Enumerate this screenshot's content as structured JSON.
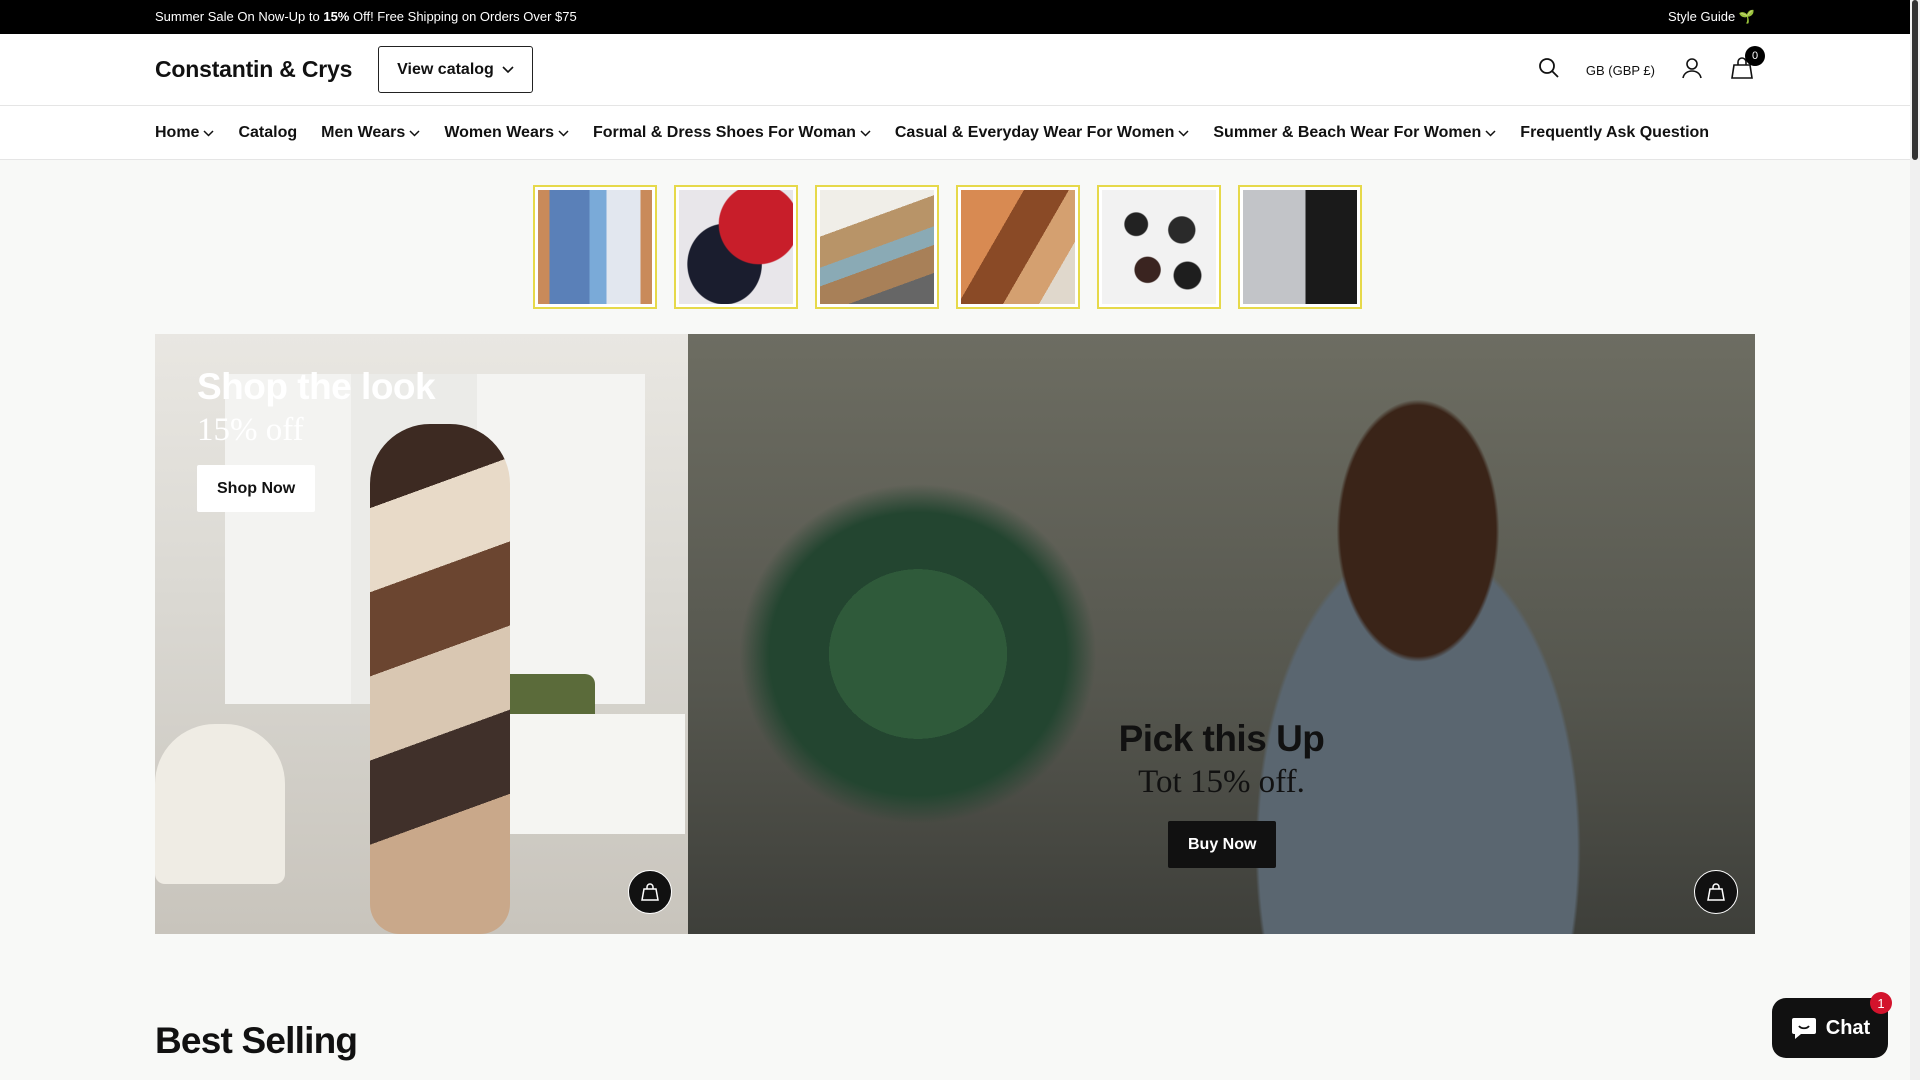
{
  "announcement": {
    "text_before": "Summer Sale On Now-Up to ",
    "text_bold": "15%",
    "text_after": " Off! Free Shipping on Orders Over $75",
    "style_guide": "Style Guide 🌱"
  },
  "header": {
    "logo": "Constantin & Crys",
    "catalog_button": "View catalog",
    "currency": "GB (GBP £)",
    "cart_count": "0"
  },
  "nav": {
    "items": [
      {
        "label": "Home",
        "dropdown": true
      },
      {
        "label": "Catalog",
        "dropdown": false
      },
      {
        "label": "Men Wears",
        "dropdown": true
      },
      {
        "label": "Women Wears",
        "dropdown": true
      },
      {
        "label": "Formal & Dress Shoes For Woman",
        "dropdown": true
      },
      {
        "label": "Casual & Everyday Wear For Women",
        "dropdown": true
      },
      {
        "label": "Summer & Beach Wear For Women",
        "dropdown": true
      },
      {
        "label": "Frequently Ask Question",
        "dropdown": false
      }
    ]
  },
  "thumbnails": [
    {
      "name": "shirts-and-jeans"
    },
    {
      "name": "caps"
    },
    {
      "name": "sneakers"
    },
    {
      "name": "accessories"
    },
    {
      "name": "boots"
    },
    {
      "name": "shorts"
    }
  ],
  "hero": {
    "left": {
      "title": "Shop the look",
      "subtitle": "15% off",
      "button": "Shop Now"
    },
    "right": {
      "title": "Pick this Up",
      "subtitle": "Tot 15% off.",
      "button": "Buy Now"
    }
  },
  "sections": {
    "best_selling": "Best Selling"
  },
  "chat": {
    "label": "Chat",
    "badge": "1"
  },
  "colors": {
    "announcement_bg": "#000000",
    "thumb_border": "#e6d94a",
    "chat_badge": "#d3132c"
  }
}
